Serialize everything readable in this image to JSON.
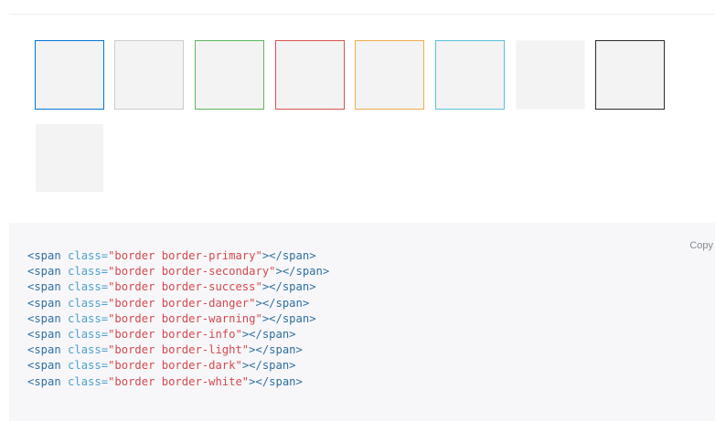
{
  "swatches": [
    {
      "name": "primary",
      "border_color": "#0275d8"
    },
    {
      "name": "secondary",
      "border_color": "#cccccc"
    },
    {
      "name": "success",
      "border_color": "#5cb85c"
    },
    {
      "name": "danger",
      "border_color": "#d9534f"
    },
    {
      "name": "warning",
      "border_color": "#f0ad4e"
    },
    {
      "name": "info",
      "border_color": "#5bc0de"
    },
    {
      "name": "light",
      "border_color": "#f7f7f9"
    },
    {
      "name": "dark",
      "border_color": "#292b2c"
    },
    {
      "name": "white",
      "border_color": "#ffffff"
    }
  ],
  "code": {
    "copy_label": "Copy",
    "open_tag": "<span",
    "attr": " class=",
    "close_tag": "></span>",
    "lines": [
      "\"border border-primary\"",
      "\"border border-secondary\"",
      "\"border border-success\"",
      "\"border border-danger\"",
      "\"border border-warning\"",
      "\"border border-info\"",
      "\"border border-light\"",
      "\"border border-dark\"",
      "\"border border-white\""
    ]
  }
}
